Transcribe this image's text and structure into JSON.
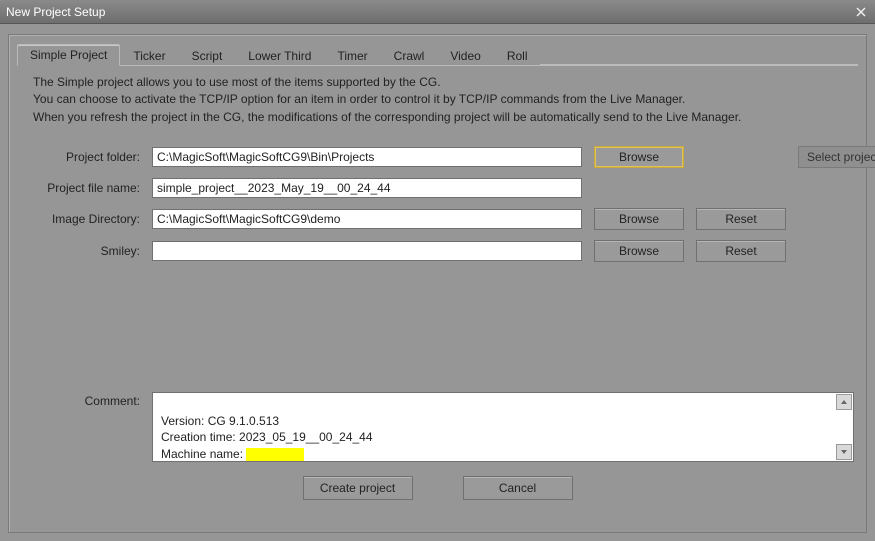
{
  "window": {
    "title": "New Project Setup"
  },
  "tabs": [
    {
      "label": "Simple Project"
    },
    {
      "label": "Ticker"
    },
    {
      "label": "Script"
    },
    {
      "label": "Lower Third"
    },
    {
      "label": "Timer"
    },
    {
      "label": "Crawl"
    },
    {
      "label": "Video"
    },
    {
      "label": "Roll"
    }
  ],
  "description": {
    "l1": "The Simple project allows you to use most of the items supported by the CG.",
    "l2": "You can choose to activate the  TCP/IP option for an item in order to control it by TCP/IP commands from the Live Manager.",
    "l3": "When you refresh the project in the CG, the modifications of the corresponding project will be automatically send to the Live Manager."
  },
  "labels": {
    "project_folder": "Project folder:",
    "project_file": "Project file name:",
    "image_dir": "Image Directory:",
    "smiley": "Smiley:",
    "comment": "Comment:"
  },
  "fields": {
    "project_folder": "C:\\MagicSoft\\MagicSoftCG9\\Bin\\Projects",
    "project_file": "simple_project__2023_May_19__00_24_44",
    "image_dir": "C:\\MagicSoft\\MagicSoftCG9\\demo",
    "smiley": ""
  },
  "buttons": {
    "browse": "Browse",
    "reset": "Reset",
    "create": "Create project",
    "cancel": "Cancel"
  },
  "hints": {
    "select_path": "Select project path"
  },
  "comment": {
    "version_label": "Version: ",
    "version_value": "CG 9.1.0.513",
    "creation_label": "Creation time: ",
    "creation_value": "2023_05_19__00_24_44",
    "machine_label": "Machine name: "
  }
}
